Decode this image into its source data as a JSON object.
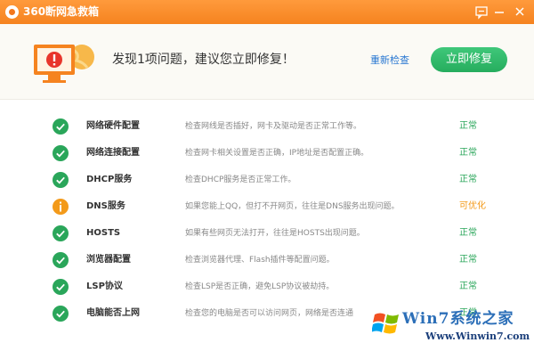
{
  "window": {
    "title": "360断网急救箱"
  },
  "header": {
    "message": "发现1项问题，建议您立即修复！",
    "recheck_label": "重新检查",
    "fix_label": "立即修复"
  },
  "rows": [
    {
      "name": "网络硬件配置",
      "desc": "检查网线是否插好，网卡及驱动是否正常工作等。",
      "status": "正常",
      "state": "ok"
    },
    {
      "name": "网络连接配置",
      "desc": "检查网卡相关设置是否正确，IP地址是否配置正确。",
      "status": "正常",
      "state": "ok"
    },
    {
      "name": "DHCP服务",
      "desc": "检查DHCP服务是否正常工作。",
      "status": "正常",
      "state": "ok"
    },
    {
      "name": "DNS服务",
      "desc": "如果您能上QQ，但打不开网页，往往是DNS服务出现问题。",
      "status": "可优化",
      "state": "warn"
    },
    {
      "name": "HOSTS",
      "desc": "如果有些网页无法打开，往往是HOSTS出现问题。",
      "status": "正常",
      "state": "ok"
    },
    {
      "name": "浏览器配置",
      "desc": "检查浏览器代理、Flash插件等配置问题。",
      "status": "正常",
      "state": "ok"
    },
    {
      "name": "LSP协议",
      "desc": "检查LSP是否正确，避免LSP协议被劫持。",
      "status": "正常",
      "state": "ok"
    },
    {
      "name": "电脑能否上网",
      "desc": "检查您的电脑是否可以访问网页，网络是否连通",
      "status": "正常",
      "state": "ok"
    }
  ],
  "watermark": {
    "brand": "Win7系统之家",
    "url": "Www.Winwin7.com"
  },
  "colors": {
    "accent": "#f5831f",
    "ok": "#2aa65a",
    "warn": "#f39a1a",
    "button": "#26ad5e"
  }
}
